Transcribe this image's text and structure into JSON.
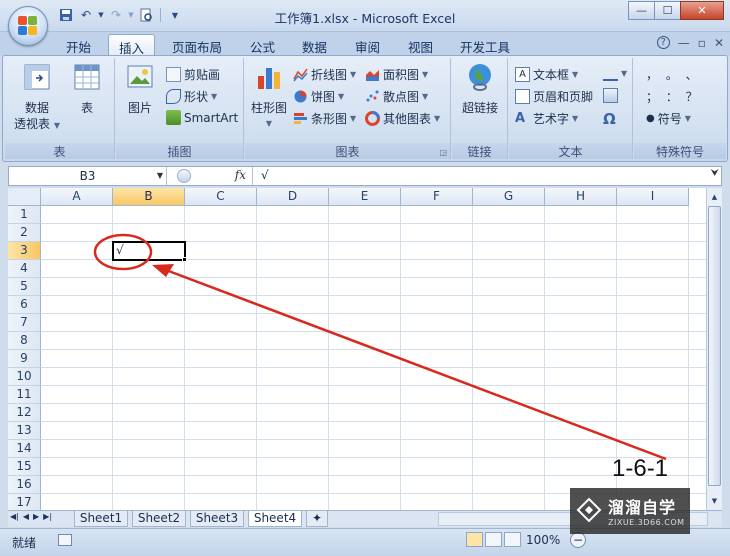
{
  "window": {
    "title": "工作簿1.xlsx - Microsoft Excel",
    "controls": {
      "minimize": "—",
      "maximize": "☐",
      "close": "✕"
    }
  },
  "quick_access": [
    "save-icon",
    "undo-icon",
    "redo-icon",
    "print-preview-icon",
    "customize-dropdown-icon"
  ],
  "tabs": [
    "开始",
    "插入",
    "页面布局",
    "公式",
    "数据",
    "审阅",
    "视图",
    "开发工具"
  ],
  "active_tab": "插入",
  "tab_right": {
    "help": "?",
    "min": "—",
    "restore": "▫",
    "close": "✕"
  },
  "ribbon": {
    "groups": [
      {
        "label": "表",
        "buttons": {
          "pivot_line1": "数据",
          "pivot_line2": "透视表",
          "table": "表"
        }
      },
      {
        "label": "插图",
        "buttons": {
          "picture": "图片",
          "clipart": "剪贴画",
          "shapes": "形状",
          "smartart": "SmartArt"
        }
      },
      {
        "label": "图表",
        "buttons": {
          "column": "柱形图",
          "line": "折线图",
          "pie": "饼图",
          "bar": "条形图",
          "area": "面积图",
          "scatter": "散点图",
          "other": "其他图表"
        }
      },
      {
        "label": "链接",
        "buttons": {
          "hyperlink": "超链接"
        }
      },
      {
        "label": "文本",
        "buttons": {
          "textbox": "文本框",
          "header_footer": "页眉和页脚",
          "wordart": "艺术字"
        }
      },
      {
        "label": "特殊符号",
        "buttons": {
          "symbols_row1": "，  。  、",
          "symbols_row2": "；  ：  ？",
          "symbol": "符号"
        }
      }
    ]
  },
  "formula_bar": {
    "name_box": "B3",
    "fx": "fx",
    "value": "√"
  },
  "grid": {
    "columns": [
      "A",
      "B",
      "C",
      "D",
      "E",
      "F",
      "G",
      "H",
      "I"
    ],
    "rows": [
      "1",
      "2",
      "3",
      "4",
      "5",
      "6",
      "7",
      "8",
      "9",
      "10",
      "11",
      "12",
      "13",
      "14",
      "15",
      "16",
      "17"
    ],
    "selected_column": "B",
    "selected_row": "3",
    "cells": {
      "B3": "√"
    }
  },
  "sheets": [
    "Sheet1",
    "Sheet2",
    "Sheet3",
    "Sheet4"
  ],
  "active_sheet": "Sheet4",
  "status": {
    "ready": "就绪",
    "zoom": "100%"
  },
  "annotation": {
    "label": "1-6-1",
    "color": "#d9291c"
  },
  "watermark": {
    "title": "溜溜自学",
    "url": "ZIXUE.3D66.COM"
  }
}
